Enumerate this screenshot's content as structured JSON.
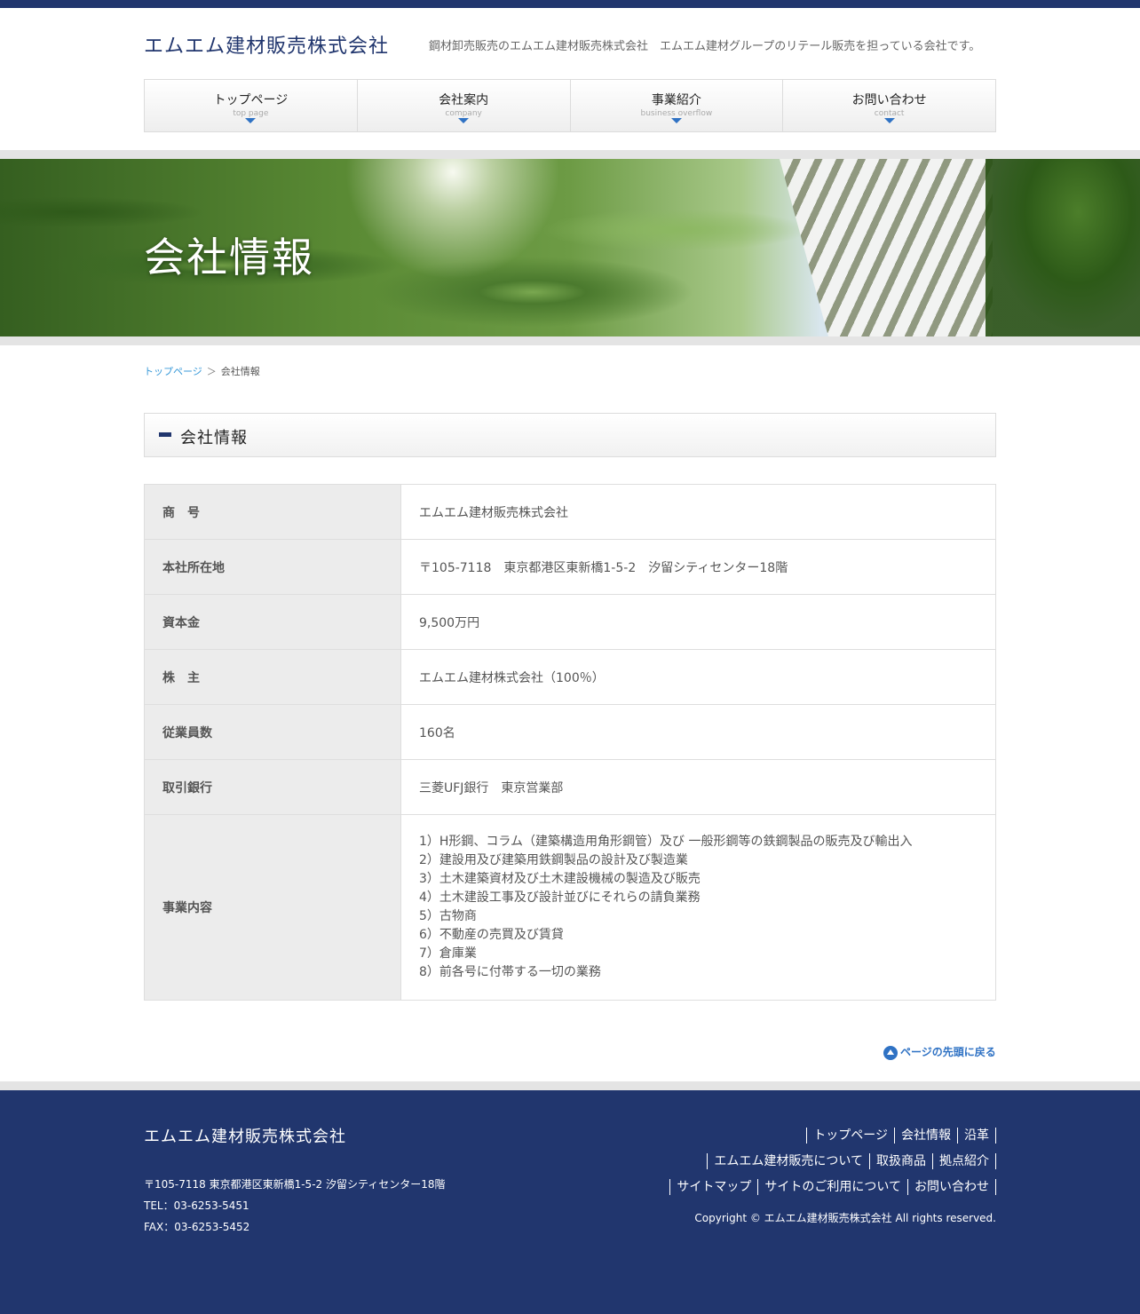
{
  "header": {
    "logo": "エムエム建材販売株式会社",
    "tagline": "鋼材卸売販売のエムエム建材販売株式会社　エムエム建材グループのリテール販売を担っている会社です。"
  },
  "nav": [
    {
      "jp": "トップページ",
      "en": "top page"
    },
    {
      "jp": "会社案内",
      "en": "company"
    },
    {
      "jp": "事業紹介",
      "en": "business overflow"
    },
    {
      "jp": "お問い合わせ",
      "en": "contact"
    }
  ],
  "hero": {
    "title": "会社情報"
  },
  "breadcrumb": {
    "home": "トップページ",
    "sep": "＞",
    "current": "会社情報"
  },
  "section": {
    "title": "会社情報"
  },
  "table": [
    {
      "label": "商　号",
      "value": "エムエム建材販売株式会社"
    },
    {
      "label": "本社所在地",
      "value": "〒105-7118　東京都港区東新橋1-5-2　汐留シティセンター18階"
    },
    {
      "label": "資本金",
      "value": "9,500万円"
    },
    {
      "label": "株　主",
      "value": "エムエム建材株式会社（100％）"
    },
    {
      "label": "従業員数",
      "value": "160名"
    },
    {
      "label": "取引銀行",
      "value": "三菱UFJ銀行　東京営業部"
    }
  ],
  "business": {
    "label": "事業内容",
    "items": [
      "1）H形鋼、コラム（建築構造用角形鋼管）及び 一般形鋼等の鉄鋼製品の販売及び輸出入",
      "2）建設用及び建築用鉄鋼製品の設計及び製造業",
      "3）土木建築資材及び土木建設機械の製造及び販売",
      "4）土木建設工事及び設計並びにそれらの請負業務",
      "5）古物商",
      "6）不動産の売買及び賃貸",
      "7）倉庫業",
      "8）前各号に付帯する一切の業務"
    ]
  },
  "pagetop": {
    "label": "ページの先頭に戻る"
  },
  "footer": {
    "logo": "エムエム建材販売株式会社",
    "address": "〒105-7118 東京都港区東新橋1-5-2 汐留シティセンター18階",
    "tel": "TEL：03-6253-5451",
    "fax": "FAX：03-6253-5452",
    "links_row1": [
      "トップページ",
      "会社情報",
      "沿革"
    ],
    "links_row2": [
      "エムエム建材販売について",
      "取扱商品",
      "拠点紹介"
    ],
    "links_row3": [
      "サイトマップ",
      "サイトのご利用について",
      "お問い合わせ"
    ],
    "copyright": "Copyright © エムエム建材販売株式会社 All rights reserved."
  },
  "colors": {
    "brand": "#21366e",
    "accent": "#2f72c4",
    "link": "#3a9ad9"
  }
}
